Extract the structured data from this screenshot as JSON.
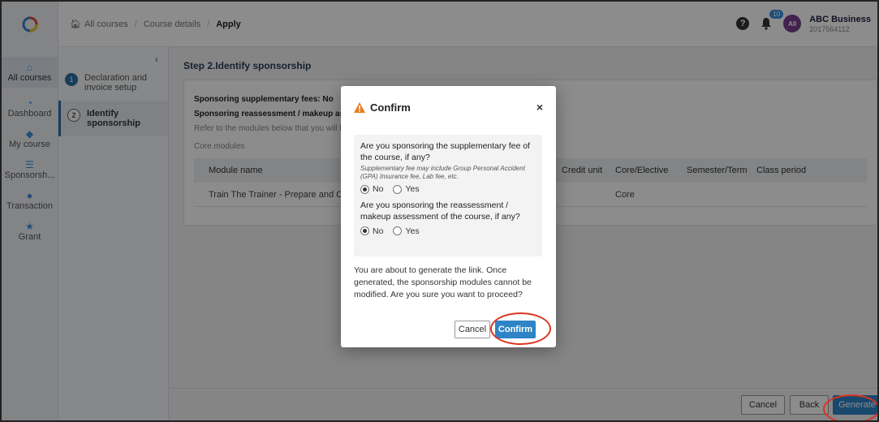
{
  "breadcrumb": {
    "home_label": "All courses",
    "course_details": "Course details",
    "current": "Apply"
  },
  "header": {
    "notification_count": "10",
    "avatar_initials": "All",
    "user_name": "ABC Business",
    "user_id": "2017564112"
  },
  "sidebar": {
    "items": [
      {
        "label": "All courses",
        "icon": "home-icon"
      },
      {
        "label": "Dashboard",
        "icon": "dashboard-icon"
      },
      {
        "label": "My course",
        "icon": "cube-icon"
      },
      {
        "label": "Sponsorsh...",
        "icon": "list-icon"
      },
      {
        "label": "Transaction",
        "icon": "coins-icon"
      },
      {
        "label": "Grant",
        "icon": "trophy-icon"
      }
    ]
  },
  "steps": {
    "collapse": "‹",
    "items": [
      {
        "number": "1",
        "label": "Declaration and invoice setup"
      },
      {
        "number": "2",
        "label": "Identify sponsorship"
      }
    ]
  },
  "main": {
    "title": "Step 2.Identify sponsorship",
    "supplementary": "Sponsoring supplementary fees: No",
    "reassessment": "Sponsoring reassessment / makeup ass",
    "refer": "Refer to the modules below that you will b",
    "core_modules": "Core modules",
    "columns": [
      "Module name",
      "Credit unit",
      "Core/Elective",
      "Semester/Term",
      "Class period"
    ],
    "rows": [
      {
        "module": "Train The Trainer - Prepare and Condu",
        "credit": "",
        "type": "Core",
        "semester": "",
        "period": ""
      }
    ]
  },
  "footer": {
    "cancel": "Cancel",
    "back": "Back",
    "generate": "Generate"
  },
  "modal": {
    "title": "Confirm",
    "close": "×",
    "q1": "Are you sponsoring the supplementary fee of the course, if any?",
    "q1_note": "Supplementary fee may include Group Personal Accident (GPA) Insurance fee, Lab fee, etc.",
    "q2": "Are you sponsoring the reassessment / makeup assessment of the course, if any?",
    "opt_no": "No",
    "opt_yes": "Yes",
    "q1_selected": "No",
    "q2_selected": "No",
    "message": "You are about to generate the link. Once generated, the sponsorship modules cannot be modified. Are you sure you want to proceed?",
    "cancel": "Cancel",
    "confirm": "Confirm"
  },
  "colors": {
    "primary": "#2e84c6",
    "annotation": "#dd3322",
    "warning": "#e67e22",
    "avatar": "#7b3f8f"
  }
}
